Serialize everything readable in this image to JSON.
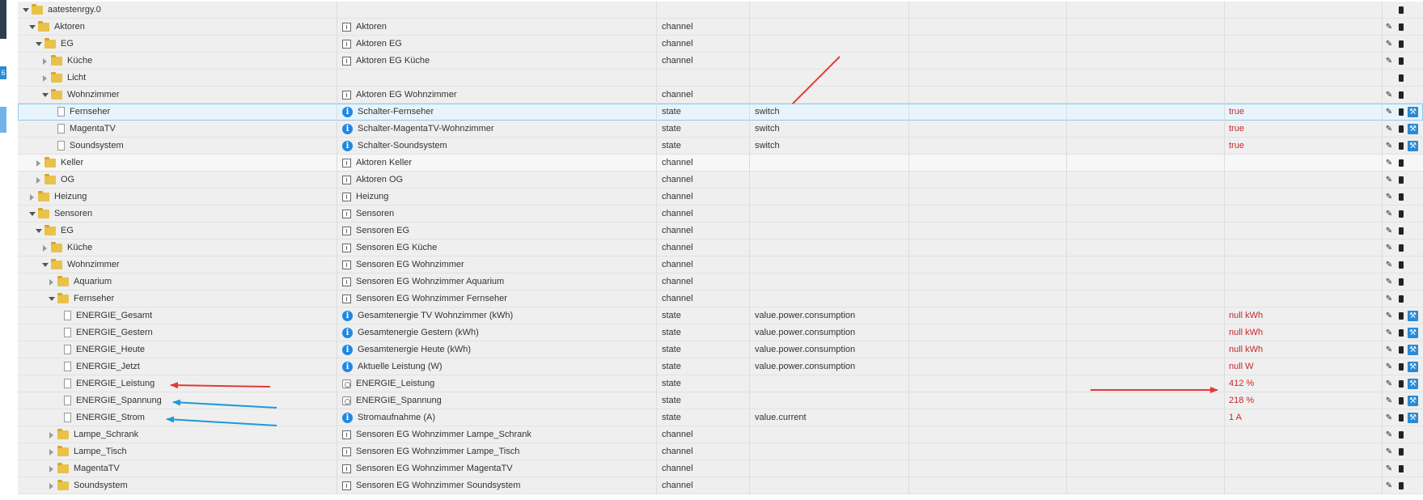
{
  "sidebar": {
    "badge": "6"
  },
  "colors": {
    "value_red": "#c62828",
    "arrow_red": "#e53935",
    "arrow_blue": "#1e9ad6",
    "info_blue": "#1e88e5"
  },
  "rows": [
    {
      "level": 0,
      "expand": "open",
      "icon": "folder",
      "name": "aatestenrgy.0",
      "desc_icon": "",
      "desc": "",
      "type": "",
      "role": "",
      "value": "",
      "actions": "d"
    },
    {
      "level": 1,
      "expand": "open",
      "icon": "folder",
      "name": "Aktoren",
      "desc_icon": "channel-icon",
      "desc": "Aktoren",
      "type": "channel",
      "role": "",
      "value": "",
      "actions": "ed"
    },
    {
      "level": 2,
      "expand": "open",
      "icon": "folder",
      "name": "EG",
      "desc_icon": "channel-icon",
      "desc": "Aktoren EG",
      "type": "channel",
      "role": "",
      "value": "",
      "actions": "ed"
    },
    {
      "level": 3,
      "expand": "closed",
      "icon": "folder",
      "name": "Küche",
      "desc_icon": "channel-icon",
      "desc": "Aktoren EG Küche",
      "type": "channel",
      "role": "",
      "value": "",
      "actions": "ed"
    },
    {
      "level": 3,
      "expand": "closed",
      "icon": "folder",
      "name": "Licht",
      "desc_icon": "",
      "desc": "",
      "type": "",
      "role": "",
      "value": "",
      "actions": "d"
    },
    {
      "level": 3,
      "expand": "open",
      "icon": "folder",
      "name": "Wohnzimmer",
      "desc_icon": "channel-icon",
      "desc": "Aktoren EG Wohnzimmer",
      "type": "channel",
      "role": "",
      "value": "",
      "actions": "ed"
    },
    {
      "level": 4,
      "expand": "none",
      "icon": "file",
      "name": "Fernseher",
      "desc_icon": "info-icon",
      "desc": "Schalter-Fernseher",
      "type": "state",
      "role": "switch",
      "value": "true",
      "actions": "edw",
      "selected": true
    },
    {
      "level": 4,
      "expand": "none",
      "icon": "file",
      "name": "MagentaTV",
      "desc_icon": "info-icon",
      "desc": "Schalter-MagentaTV-Wohnzimmer",
      "type": "state",
      "role": "switch",
      "value": "true",
      "actions": "edw"
    },
    {
      "level": 4,
      "expand": "none",
      "icon": "file",
      "name": "Soundsystem",
      "desc_icon": "info-icon",
      "desc": "Schalter-Soundsystem",
      "type": "state",
      "role": "switch",
      "value": "true",
      "actions": "edw"
    },
    {
      "level": 2,
      "expand": "closed",
      "icon": "folder",
      "name": "Keller",
      "desc_icon": "channel-icon",
      "desc": "Aktoren Keller",
      "type": "channel",
      "role": "",
      "value": "",
      "actions": "ed",
      "alt": true
    },
    {
      "level": 2,
      "expand": "closed",
      "icon": "folder",
      "name": "OG",
      "desc_icon": "channel-icon",
      "desc": "Aktoren OG",
      "type": "channel",
      "role": "",
      "value": "",
      "actions": "ed"
    },
    {
      "level": 1,
      "expand": "closed",
      "icon": "folder",
      "name": "Heizung",
      "desc_icon": "channel-icon",
      "desc": "Heizung",
      "type": "channel",
      "role": "",
      "value": "",
      "actions": "ed"
    },
    {
      "level": 1,
      "expand": "open",
      "icon": "folder",
      "name": "Sensoren",
      "desc_icon": "channel-icon",
      "desc": "Sensoren",
      "type": "channel",
      "role": "",
      "value": "",
      "actions": "ed"
    },
    {
      "level": 2,
      "expand": "open",
      "icon": "folder",
      "name": "EG",
      "desc_icon": "channel-icon",
      "desc": "Sensoren EG",
      "type": "channel",
      "role": "",
      "value": "",
      "actions": "ed"
    },
    {
      "level": 3,
      "expand": "closed",
      "icon": "folder",
      "name": "Küche",
      "desc_icon": "channel-icon",
      "desc": "Sensoren EG Küche",
      "type": "channel",
      "role": "",
      "value": "",
      "actions": "ed"
    },
    {
      "level": 3,
      "expand": "open",
      "icon": "folder",
      "name": "Wohnzimmer",
      "desc_icon": "channel-icon",
      "desc": "Sensoren EG Wohnzimmer",
      "type": "channel",
      "role": "",
      "value": "",
      "actions": "ed"
    },
    {
      "level": 4,
      "expand": "closed",
      "icon": "folder",
      "name": "Aquarium",
      "desc_icon": "channel-icon",
      "desc": "Sensoren EG Wohnzimmer Aquarium",
      "type": "channel",
      "role": "",
      "value": "",
      "actions": "ed"
    },
    {
      "level": 4,
      "expand": "open",
      "icon": "folder",
      "name": "Fernseher",
      "desc_icon": "channel-icon",
      "desc": "Sensoren EG Wohnzimmer Fernseher",
      "type": "channel",
      "role": "",
      "value": "",
      "actions": "ed"
    },
    {
      "level": 5,
      "expand": "none",
      "icon": "file",
      "name": "ENERGIE_Gesamt",
      "desc_icon": "info-icon",
      "desc": "Gesamtenergie TV Wohnzimmer (kWh)",
      "type": "state",
      "role": "value.power.consumption",
      "value": "null kWh",
      "actions": "edw"
    },
    {
      "level": 5,
      "expand": "none",
      "icon": "file",
      "name": "ENERGIE_Gestern",
      "desc_icon": "info-icon",
      "desc": "Gesamtenergie Gestern (kWh)",
      "type": "state",
      "role": "value.power.consumption",
      "value": "null kWh",
      "actions": "edw"
    },
    {
      "level": 5,
      "expand": "none",
      "icon": "file",
      "name": "ENERGIE_Heute",
      "desc_icon": "info-icon",
      "desc": "Gesamtenergie Heute (kWh)",
      "type": "state",
      "role": "value.power.consumption",
      "value": "null kWh",
      "actions": "edw"
    },
    {
      "level": 5,
      "expand": "none",
      "icon": "file",
      "name": "ENERGIE_Jetzt",
      "desc_icon": "info-icon",
      "desc": "Aktuelle Leistung (W)",
      "type": "state",
      "role": "value.power.consumption",
      "value": "null W",
      "actions": "edw"
    },
    {
      "level": 5,
      "expand": "none",
      "icon": "file",
      "name": "ENERGIE_Leistung",
      "desc_icon": "sensor-icon",
      "desc": "ENERGIE_Leistung",
      "type": "state",
      "role": "",
      "value": "412 %",
      "actions": "edw"
    },
    {
      "level": 5,
      "expand": "none",
      "icon": "file",
      "name": "ENERGIE_Spannung",
      "desc_icon": "sensor-icon",
      "desc": "ENERGIE_Spannung",
      "type": "state",
      "role": "",
      "value": "218 %",
      "actions": "edw"
    },
    {
      "level": 5,
      "expand": "none",
      "icon": "file",
      "name": "ENERGIE_Strom",
      "desc_icon": "info-icon",
      "desc": "Stromaufnahme (A)",
      "type": "state",
      "role": "value.current",
      "value": "1 A",
      "actions": "edw"
    },
    {
      "level": 4,
      "expand": "closed",
      "icon": "folder",
      "name": "Lampe_Schrank",
      "desc_icon": "channel-icon",
      "desc": "Sensoren EG Wohnzimmer Lampe_Schrank",
      "type": "channel",
      "role": "",
      "value": "",
      "actions": "ed"
    },
    {
      "level": 4,
      "expand": "closed",
      "icon": "folder",
      "name": "Lampe_Tisch",
      "desc_icon": "channel-icon",
      "desc": "Sensoren EG Wohnzimmer Lampe_Tisch",
      "type": "channel",
      "role": "",
      "value": "",
      "actions": "ed"
    },
    {
      "level": 4,
      "expand": "closed",
      "icon": "folder",
      "name": "MagentaTV",
      "desc_icon": "channel-icon",
      "desc": "Sensoren EG Wohnzimmer MagentaTV",
      "type": "channel",
      "role": "",
      "value": "",
      "actions": "ed"
    },
    {
      "level": 4,
      "expand": "closed",
      "icon": "folder",
      "name": "Soundsystem",
      "desc_icon": "channel-icon",
      "desc": "Sensoren EG Wohnzimmer Soundsystem",
      "type": "channel",
      "role": "",
      "value": "",
      "actions": "ed"
    }
  ]
}
